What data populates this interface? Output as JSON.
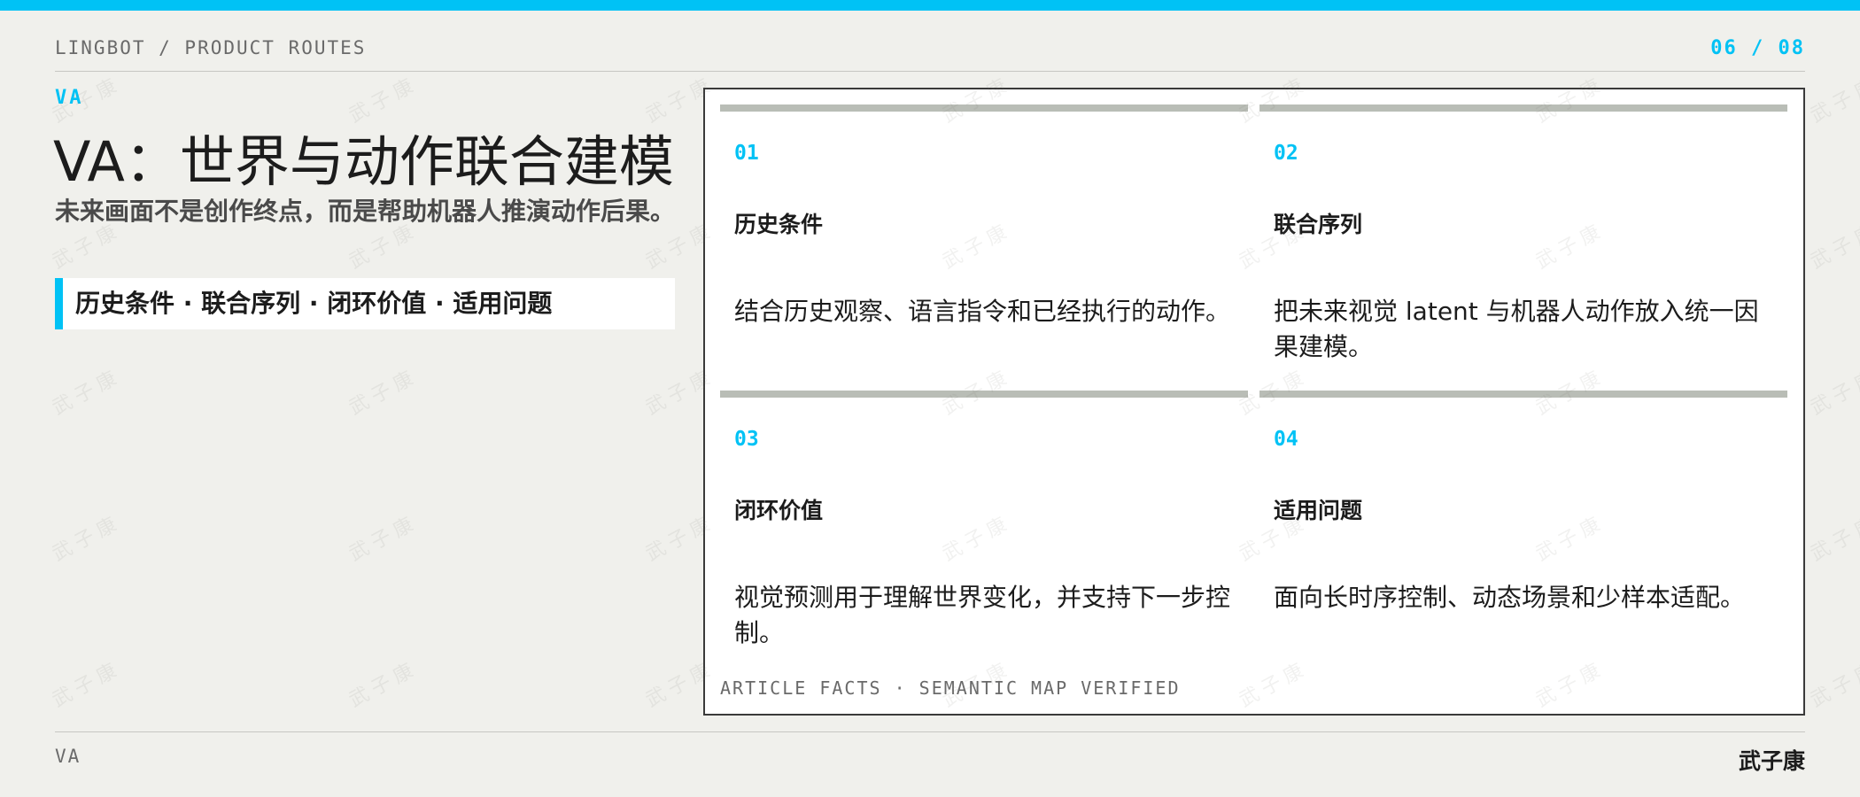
{
  "header": {
    "breadcrumb": "LINGBOT / PRODUCT ROUTES",
    "page": "06 / 08"
  },
  "hero": {
    "kicker": "VA",
    "title": "VA：世界与动作联合建模",
    "subtitle": "未来画面不是创作终点，而是帮助机器人推演动作后果。",
    "tagline": "历史条件 · 联合序列 · 闭环价值 · 适用问题"
  },
  "cards": [
    {
      "num": "01",
      "heading": "历史条件",
      "body": "结合历史观察、语言指令和已经执行的动作。"
    },
    {
      "num": "02",
      "heading": "联合序列",
      "body": "把未来视觉 latent 与机器人动作放入统一因果建模。"
    },
    {
      "num": "03",
      "heading": "闭环价值",
      "body": "视觉预测用于理解世界变化，并支持下一步控制。"
    },
    {
      "num": "04",
      "heading": "适用问题",
      "body": "面向长时序控制、动态场景和少样本适配。"
    }
  ],
  "panel_footer": "ARTICLE FACTS · SEMANTIC MAP VERIFIED",
  "footer": {
    "left": "VA",
    "author": "武子康"
  },
  "watermark": "武子康",
  "colors": {
    "accent": "#00c2f5",
    "background": "#f0f0ec",
    "card_bar": "#b9bdb6"
  }
}
